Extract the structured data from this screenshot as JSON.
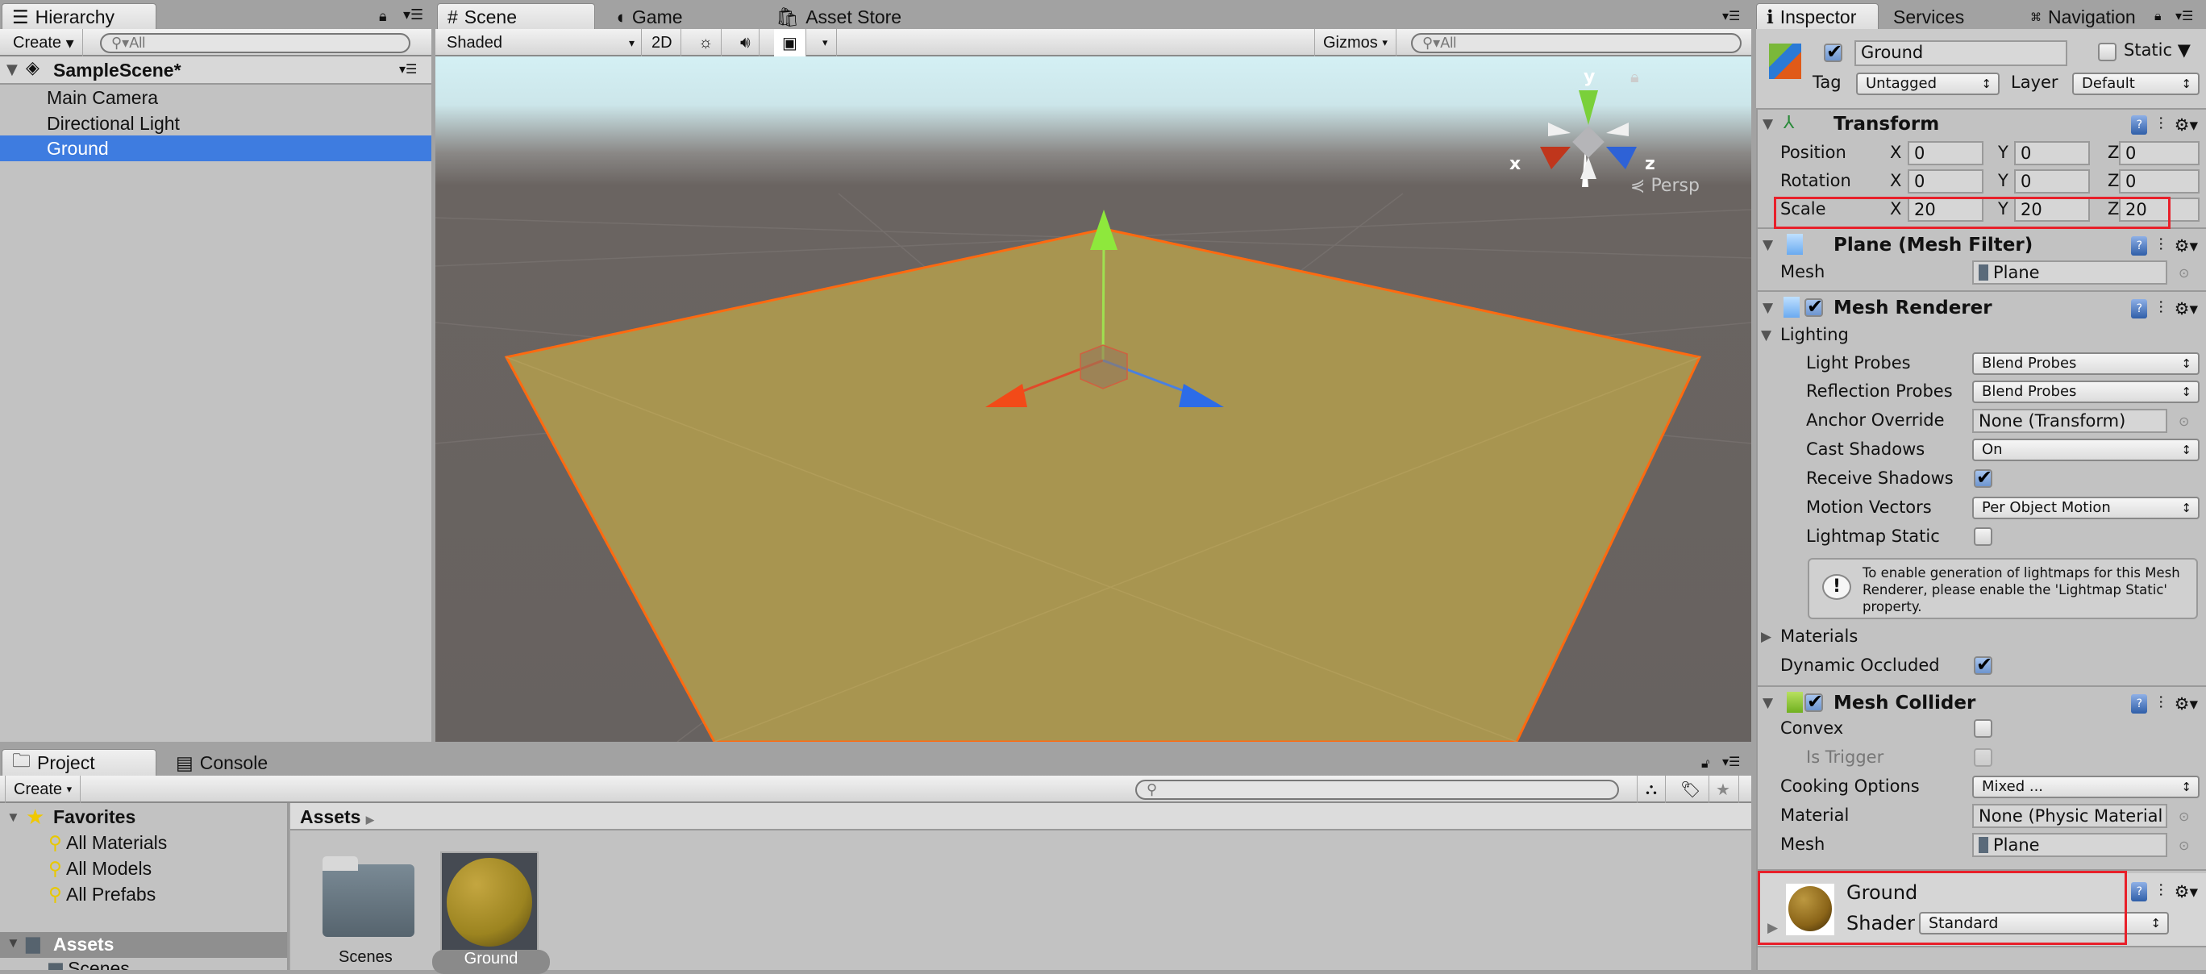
{
  "hierarchy": {
    "tab": "Hierarchy",
    "create": "Create",
    "search_placeholder": "All",
    "scene": "SampleScene*",
    "items": [
      {
        "label": "Main Camera"
      },
      {
        "label": "Directional Light"
      },
      {
        "label": "Ground",
        "selected": true
      }
    ]
  },
  "scene": {
    "tabs": [
      {
        "label": "Scene"
      },
      {
        "label": "Game"
      },
      {
        "label": "Asset Store"
      }
    ],
    "shading": "Shaded",
    "mode_2d": "2D",
    "gizmos": "Gizmos",
    "search_placeholder": "All",
    "projection": "Persp",
    "axis_labels": {
      "x": "x",
      "y": "y",
      "z": "z"
    }
  },
  "inspector": {
    "tabs": [
      {
        "label": "Inspector"
      },
      {
        "label": "Services"
      },
      {
        "label": "Navigation"
      }
    ],
    "object": {
      "active": true,
      "name": "Ground",
      "static_label": "Static",
      "static": false,
      "tag_label": "Tag",
      "tag": "Untagged",
      "layer_label": "Layer",
      "layer": "Default"
    },
    "transform": {
      "title": "Transform",
      "rows": [
        {
          "label": "Position",
          "x": "0",
          "y": "0",
          "z": "0"
        },
        {
          "label": "Rotation",
          "x": "0",
          "y": "0",
          "z": "0"
        },
        {
          "label": "Scale",
          "x": "20",
          "y": "20",
          "z": "20"
        }
      ]
    },
    "mesh_filter": {
      "title": "Plane (Mesh Filter)",
      "mesh_label": "Mesh",
      "mesh": "Plane"
    },
    "mesh_renderer": {
      "title": "Mesh Renderer",
      "enabled": true,
      "lighting": "Lighting",
      "light_probes_label": "Light Probes",
      "light_probes": "Blend Probes",
      "reflection_probes_label": "Reflection Probes",
      "reflection_probes": "Blend Probes",
      "anchor_label": "Anchor Override",
      "anchor": "None (Transform)",
      "cast_shadows_label": "Cast Shadows",
      "cast_shadows": "On",
      "receive_shadows_label": "Receive Shadows",
      "receive_shadows": true,
      "motion_vectors_label": "Motion Vectors",
      "motion_vectors": "Per Object Motion",
      "lightmap_static_label": "Lightmap Static",
      "lightmap_static": false,
      "help": "To enable generation of lightmaps for this Mesh Renderer, please enable the 'Lightmap Static' property.",
      "materials": "Materials",
      "dynamic_occluded_label": "Dynamic Occluded",
      "dynamic_occluded": true
    },
    "mesh_collider": {
      "title": "Mesh Collider",
      "enabled": true,
      "convex_label": "Convex",
      "convex": false,
      "is_trigger_label": "Is Trigger",
      "is_trigger": false,
      "cooking_label": "Cooking Options",
      "cooking": "Mixed ...",
      "material_label": "Material",
      "material": "None (Physic Material",
      "mesh_label": "Mesh",
      "mesh": "Plane"
    },
    "material": {
      "name": "Ground",
      "shader_label": "Shader",
      "shader": "Standard"
    }
  },
  "project": {
    "tabs": [
      {
        "label": "Project"
      },
      {
        "label": "Console"
      }
    ],
    "create": "Create",
    "favorites": "Favorites",
    "favorite_items": [
      {
        "label": "All Materials"
      },
      {
        "label": "All Models"
      },
      {
        "label": "All Prefabs"
      }
    ],
    "assets_root": "Assets",
    "assets_child": "Scenes",
    "breadcrumb": "Assets",
    "grid": [
      {
        "label": "Scenes",
        "type": "folder"
      },
      {
        "label": "Ground",
        "type": "material",
        "selected": true
      }
    ]
  },
  "colors": {
    "selection": "#3e7ce0",
    "highlight": "#e8202a",
    "plane": "#a89550",
    "outline": "#ff6a10"
  }
}
